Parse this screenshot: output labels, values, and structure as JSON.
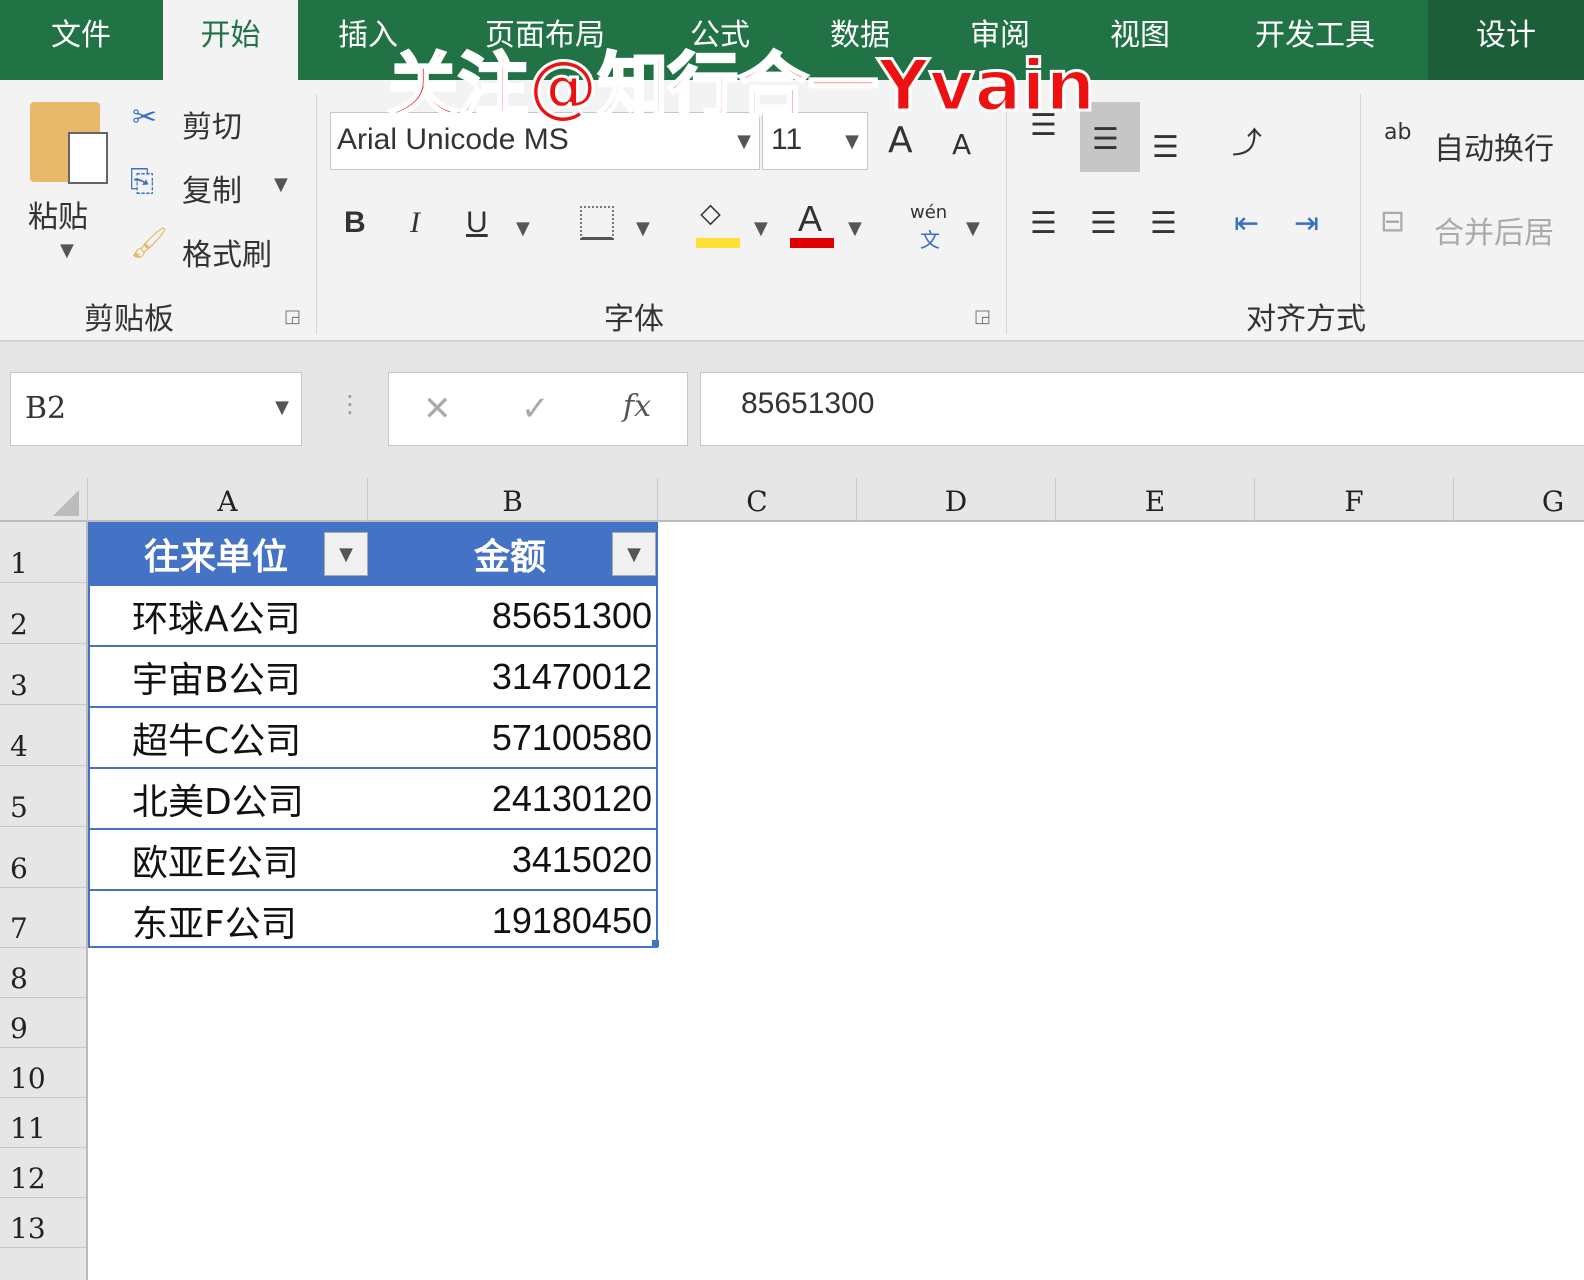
{
  "tabs": [
    "文件",
    "开始",
    "插入",
    "页面布局",
    "公式",
    "数据",
    "审阅",
    "视图",
    "开发工具",
    "设计"
  ],
  "active_tab": "开始",
  "watermark": "关注@知行合一Yvain",
  "clipboard": {
    "paste": "粘贴",
    "cut": "剪切",
    "copy": "复制",
    "format_painter": "格式刷",
    "group": "剪贴板"
  },
  "font": {
    "name": "Arial Unicode MS",
    "size": "11",
    "group": "字体",
    "bold": "B",
    "italic": "I",
    "underline": "U",
    "phonetic_top": "wén",
    "phonetic_bottom": "文",
    "font_color_letter": "A",
    "grow": "A",
    "shrink": "A"
  },
  "alignment": {
    "wrap": "自动换行",
    "merge": "合并后居",
    "group": "对齐方式"
  },
  "colors": {
    "ribbon_green": "#217346",
    "table_header": "#4472c4",
    "fill_yellow": "#ffe135",
    "font_red": "#e00000"
  },
  "formula_bar": {
    "name_box": "B2",
    "cancel": "✕",
    "enter": "✓",
    "fx": "fx",
    "value": "85651300"
  },
  "columns": [
    "A",
    "B",
    "C",
    "D",
    "E",
    "F",
    "G"
  ],
  "rows": [
    "1",
    "2",
    "3",
    "4",
    "5",
    "6",
    "7",
    "8",
    "9",
    "10",
    "11",
    "12",
    "13"
  ],
  "table": {
    "headers": [
      "往来单位",
      "金额"
    ],
    "rows": [
      [
        "环球A公司",
        "85651300"
      ],
      [
        "宇宙B公司",
        "31470012"
      ],
      [
        "超牛C公司",
        "57100580"
      ],
      [
        "北美D公司",
        "24130120"
      ],
      [
        "欧亚E公司",
        "3415020"
      ],
      [
        "东亚F公司",
        "19180450"
      ]
    ]
  }
}
